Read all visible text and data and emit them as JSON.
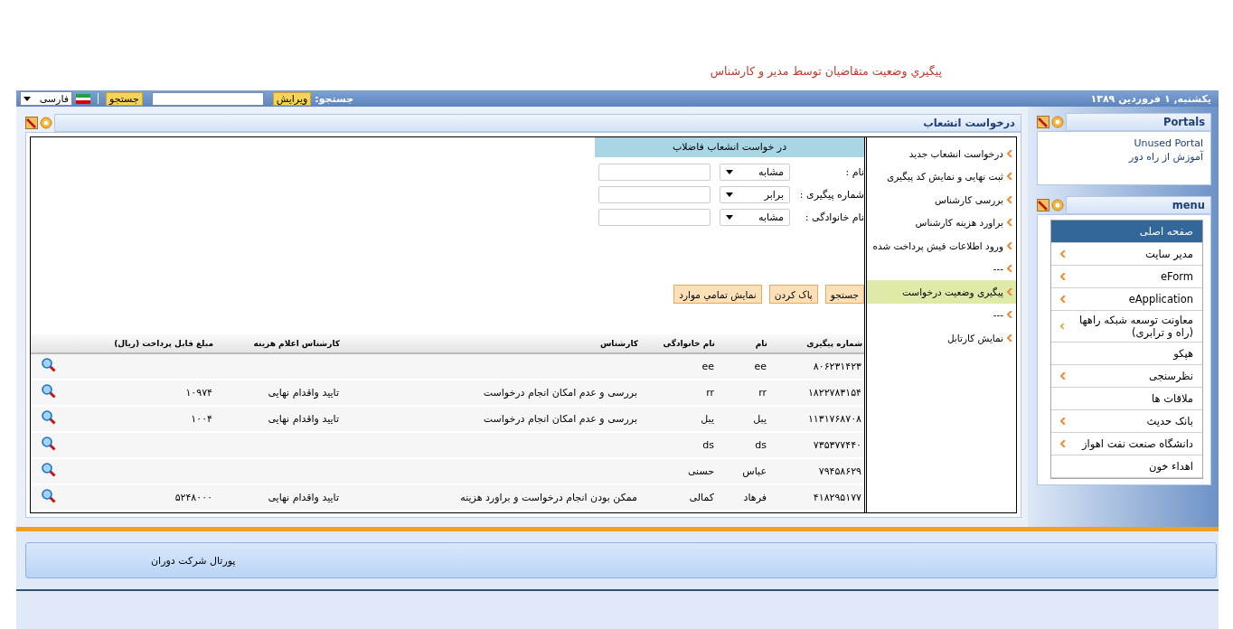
{
  "caption": "پيگيري  وضعيت متقاضيان توسط مدير و كارشناس",
  "top_bar": {
    "date": "یکشنبه, ۱ فروردین ۱۳۸۹",
    "search_label": "جستجو:",
    "edit_button": "ويرايش",
    "search_button": "جستجو",
    "language": "فارسی"
  },
  "portals": {
    "title": "Portals",
    "links": [
      "Unused Portal",
      "آموزش از راه دور"
    ]
  },
  "menu": {
    "title": "menu",
    "items": [
      {
        "label": "صفحه اصلی",
        "selected": true,
        "expandable": false
      },
      {
        "label": "مدیر سایت",
        "selected": false,
        "expandable": true
      },
      {
        "label": "eForm",
        "selected": false,
        "expandable": true
      },
      {
        "label": "eApplication",
        "selected": false,
        "expandable": true
      },
      {
        "label": "معاونت توسعه شبکه راهها (راه و ترابری)",
        "selected": false,
        "expandable": true
      },
      {
        "label": "هپکو",
        "selected": false,
        "expandable": false
      },
      {
        "label": "نظرسنجی",
        "selected": false,
        "expandable": true
      },
      {
        "label": "ملاقات ها",
        "selected": false,
        "expandable": false
      },
      {
        "label": "بانک حدیث",
        "selected": false,
        "expandable": true
      },
      {
        "label": "دانشگاه صنعت نفت اهواز",
        "selected": false,
        "expandable": true
      },
      {
        "label": "اهداء خون",
        "selected": false,
        "expandable": false
      }
    ]
  },
  "panel": {
    "title": "درخواست انشعاب",
    "nav": [
      {
        "label": "درخواست انشعاب جدید",
        "selected": false
      },
      {
        "label": "ثبت نهایی و نمایش کد پیگیری",
        "selected": false
      },
      {
        "label": "بررسی کارشناس",
        "selected": false
      },
      {
        "label": "براورد هزینه کارشناس",
        "selected": false
      },
      {
        "label": "ورود اطلاعات فیش پرداخت شده",
        "selected": false
      },
      {
        "label": "---",
        "selected": false
      },
      {
        "label": "پیگیری وضعیت درخواست",
        "selected": true
      },
      {
        "label": "---",
        "selected": false
      },
      {
        "label": "نمایش کارتابل",
        "selected": false
      }
    ],
    "form": {
      "heading": "در خواست انشعاب فاضلاب",
      "fields": [
        {
          "label": "نام :",
          "operator": "مشابه"
        },
        {
          "label": "شماره پیگیری :",
          "operator": "برابر"
        },
        {
          "label": "نام خانوادگی :",
          "operator": "مشابه"
        }
      ],
      "buttons": [
        "جستجو",
        "پاک کردن",
        "نمايش تمامي موارد"
      ]
    },
    "table": {
      "columns": [
        "شماره پیگیری",
        "نام",
        "نام خانوادگی",
        "کارشناس",
        "کارشناس اعلام هزینه",
        "مبلغ قابل پرداخت (ریال)"
      ],
      "rows": [
        {
          "tracking": "۸۰۶۲۳۱۴۲۳",
          "name": "ee",
          "family": "ee"
        },
        {
          "tracking": "۱۸۲۲۷۸۳۱۵۴",
          "name": "rr",
          "family": "rr",
          "expert": "بررسی و عدم امکان انجام درخواست",
          "cost_expert": "تایید واقدام نهایی",
          "amount": "۱۰۹۷۴"
        },
        {
          "tracking": "۱۱۳۱۷۶۸۷۰۸",
          "name": "یبل",
          "family": "یبل",
          "expert": "بررسی و عدم امکان انجام درخواست",
          "cost_expert": "تایید واقدام نهایی",
          "amount": "۱۰۰۴"
        },
        {
          "tracking": "۷۳۵۳۷۷۴۴۰",
          "name": "ds",
          "family": "ds"
        },
        {
          "tracking": "۷۹۴۵۸۶۲۹",
          "name": "عباس",
          "family": "حسنی"
        },
        {
          "tracking": "۴۱۸۲۹۵۱۷۷",
          "name": "فرهاد",
          "family": "کمالی",
          "expert": "ممکن بودن انجام درخواست و براورد هزینه",
          "cost_expert": "تایید واقدام نهایی",
          "amount": "۵۲۴۸۰۰۰"
        }
      ]
    }
  },
  "footer": {
    "text": "پورتال شرکت دوران"
  }
}
